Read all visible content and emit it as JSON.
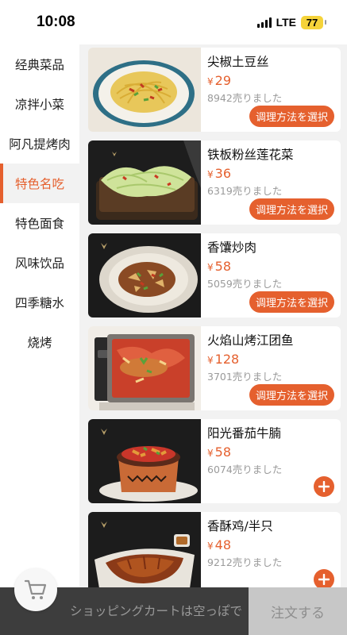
{
  "status_bar": {
    "time": "10:08",
    "network": "LTE",
    "battery": "77"
  },
  "categories": [
    {
      "label": "经典菜品"
    },
    {
      "label": "凉拌小菜"
    },
    {
      "label": "阿凡提烤肉"
    },
    {
      "label": "特色名吃",
      "active": true
    },
    {
      "label": "特色面食"
    },
    {
      "label": "风味饮品"
    },
    {
      "label": "四季糖水"
    },
    {
      "label": "烧烤"
    }
  ],
  "currency_symbol": "¥",
  "dishes": [
    {
      "name": "尖椒土豆丝",
      "price": "29",
      "sold": "8942売りました",
      "action": "调理方法を選択"
    },
    {
      "name": "铁板粉丝莲花菜",
      "price": "36",
      "sold": "6319売りました",
      "action": "调理方法を選択"
    },
    {
      "name": "香馕炒肉",
      "price": "58",
      "sold": "5059売りました",
      "action": "调理方法を選択"
    },
    {
      "name": "火焰山烤江团鱼",
      "price": "128",
      "sold": "3701売りました",
      "action": "调理方法を選択"
    },
    {
      "name": "阳光番茄牛腩",
      "price": "58",
      "sold": "6074売りました",
      "action": "plus-icon"
    },
    {
      "name": "香酥鸡/半只",
      "price": "48",
      "sold": "9212売りました",
      "action": "plus-icon"
    }
  ],
  "cart": {
    "empty_text": "ショッピングカートは空っぽで",
    "order_button": "注文する",
    "icon": "shopping-cart-icon"
  },
  "colors": {
    "accent": "#e5602e",
    "cart_bar": "#3d3d3d",
    "order_disabled": "#c7c7c7"
  }
}
